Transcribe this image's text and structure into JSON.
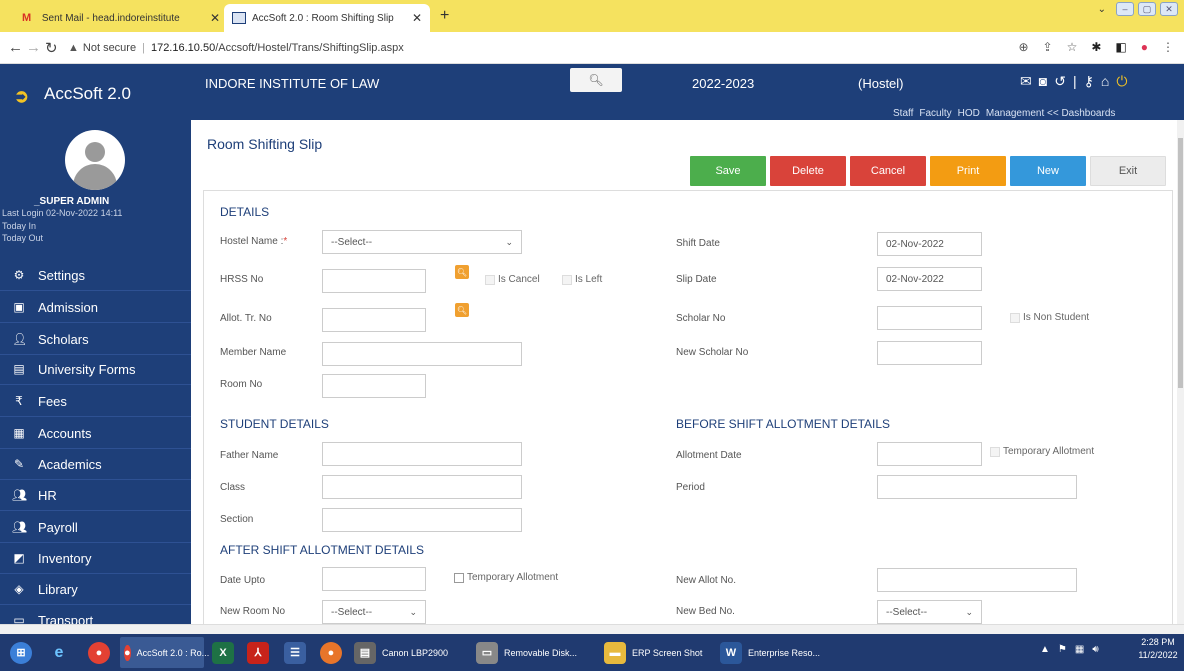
{
  "browser": {
    "tabs": [
      {
        "label": "Sent Mail - head.indoreinstitute",
        "close": "✕"
      },
      {
        "label": "AccSoft 2.0 : Room Shifting Slip",
        "close": "✕"
      }
    ],
    "new_tab": "+",
    "url_warning": "Not secure",
    "url_host": "172.16.10.50",
    "url_path": "/Accsoft/Hostel/Trans/ShiftingSlip.aspx",
    "icons": [
      "back-icon",
      "forward-icon",
      "reload-icon",
      "zoom-icon",
      "share-icon",
      "star-icon",
      "extensions-icon",
      "sidebar-icon",
      "profile-icon",
      "menu-icon"
    ]
  },
  "header": {
    "app_name": "AccSoft 2.0",
    "institute": "INDORE INSTITUTE OF LAW",
    "session": "2022-2023",
    "mode": "(Hostel)",
    "links": [
      "Staff",
      "Faculty",
      "HOD",
      "Management << Dashboards"
    ]
  },
  "user": {
    "name": "_SUPER ADMIN",
    "last_login": "Last Login  02-Nov-2022 14:11",
    "today_in": "Today In",
    "today_out": "Today Out"
  },
  "sidebar": {
    "items": [
      {
        "label": "Settings",
        "icon": "gear-icon"
      },
      {
        "label": "Admission",
        "icon": "admission-icon"
      },
      {
        "label": "Scholars",
        "icon": "user-icon"
      },
      {
        "label": "University Forms",
        "icon": "form-icon"
      },
      {
        "label": "Fees",
        "icon": "rupee-icon"
      },
      {
        "label": "Accounts",
        "icon": "ledger-icon"
      },
      {
        "label": "Academics",
        "icon": "pencil-icon"
      },
      {
        "label": "HR",
        "icon": "users-icon"
      },
      {
        "label": "Payroll",
        "icon": "users-icon"
      },
      {
        "label": "Inventory",
        "icon": "box-icon"
      },
      {
        "label": "Library",
        "icon": "book-icon"
      },
      {
        "label": "Transport",
        "icon": "bus-icon"
      }
    ]
  },
  "page": {
    "title": "Room Shifting Slip",
    "buttons": {
      "save": "Save",
      "delete": "Delete",
      "cancel": "Cancel",
      "print": "Print",
      "new": "New",
      "exit": "Exit"
    },
    "colors": {
      "save": "#4cae4c",
      "delete": "#d9433a",
      "cancel": "#d9433a",
      "print": "#f39c12",
      "new": "#3498db",
      "exit": "#ececec"
    }
  },
  "details": {
    "heading": "DETAILS",
    "hostel_name_label": "Hostel Name :",
    "required_mark": "*",
    "hostel_name_value": "--Select--",
    "hrss_no_label": "HRSS No",
    "is_cancel_label": "Is Cancel",
    "is_left_label": "Is Left",
    "allot_tr_no_label": "Allot. Tr. No",
    "member_name_label": "Member Name",
    "room_no_label": "Room No",
    "shift_date_label": "Shift Date",
    "shift_date_value": "02-Nov-2022",
    "slip_date_label": "Slip Date",
    "slip_date_value": "02-Nov-2022",
    "scholar_no_label": "Scholar No",
    "is_non_student_label": "Is Non Student",
    "new_scholar_no_label": "New Scholar No"
  },
  "student_details": {
    "heading": "STUDENT DETAILS",
    "father_name_label": "Father Name",
    "class_label": "Class",
    "section_label": "Section"
  },
  "before_shift": {
    "heading": "BEFORE SHIFT ALLOTMENT DETAILS",
    "allotment_date_label": "Allotment Date",
    "temporary_allotment_label": "Temporary Allotment",
    "period_label": "Period"
  },
  "after_shift": {
    "heading": "AFTER SHIFT ALLOTMENT DETAILS",
    "date_upto_label": "Date Upto",
    "temporary_allotment_label": "Temporary Allotment",
    "new_room_no_label": "New Room No",
    "new_room_no_value": "--Select--",
    "new_allot_no_label": "New Allot No.",
    "new_bed_no_label": "New Bed No.",
    "new_bed_no_value": "--Select--"
  },
  "taskbar": {
    "items": [
      {
        "label": "AccSoft 2.0 : Ro..."
      },
      {
        "label": "Canon LBP2900"
      },
      {
        "label": "Removable Disk..."
      },
      {
        "label": "ERP Screen Shot"
      },
      {
        "label": "Enterprise Reso..."
      }
    ],
    "time": "2:28 PM",
    "date": "11/2/2022"
  }
}
